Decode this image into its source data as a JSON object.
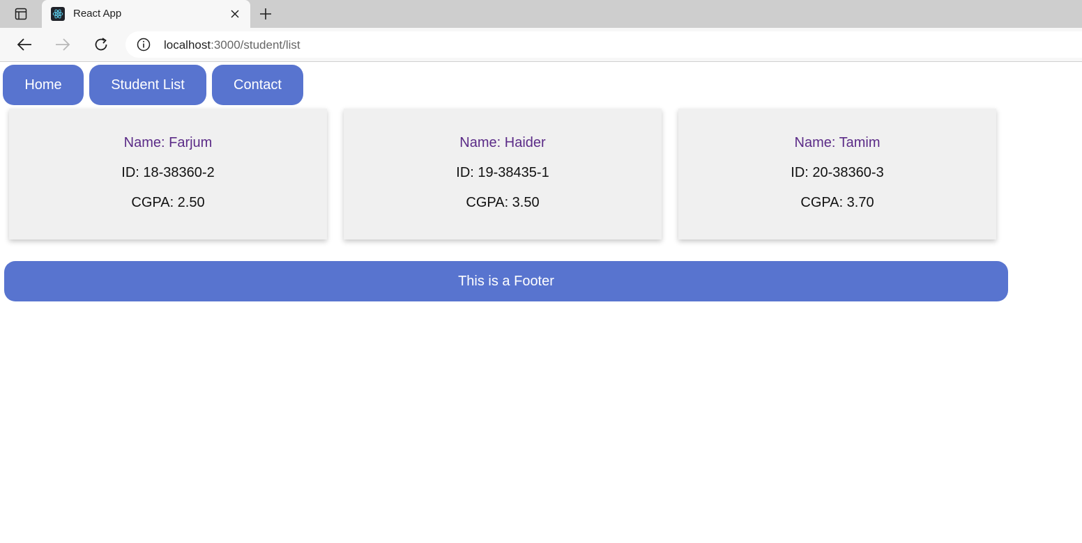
{
  "browser": {
    "tab_title": "React App",
    "url_host": "localhost",
    "url_path": ":3000/student/list",
    "icons": {
      "tab_actions": "tab-actions-icon",
      "favicon": "react-logo-icon",
      "close": "close-icon",
      "new_tab": "plus-icon",
      "back": "arrow-left-icon",
      "forward": "arrow-right-icon",
      "reload": "reload-icon",
      "site_info": "info-icon"
    }
  },
  "nav": {
    "home": "Home",
    "student_list": "Student List",
    "contact": "Contact"
  },
  "students": [
    {
      "name": "Name: Farjum",
      "id": "ID: 18-38360-2",
      "cgpa": "CGPA: 2.50"
    },
    {
      "name": "Name: Haider",
      "id": "ID: 19-38435-1",
      "cgpa": "CGPA: 3.50"
    },
    {
      "name": "Name: Tamim",
      "id": "ID: 20-38360-3",
      "cgpa": "CGPA: 3.70"
    }
  ],
  "footer": {
    "text": "This is a Footer"
  },
  "colors": {
    "accent": "#5874cf",
    "card_bg": "#f0f0f0",
    "name_text": "#5b2b87"
  }
}
